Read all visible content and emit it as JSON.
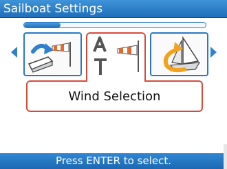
{
  "title": "Sailboat Settings",
  "progress": 0.2,
  "carousel": {
    "items": [
      {
        "name": "bow-wind-icon",
        "selected": false
      },
      {
        "name": "text-wind-icon",
        "selected": true
      },
      {
        "name": "sail-rotate-icon",
        "selected": false
      }
    ],
    "selected_label": "Wind Selection"
  },
  "footer_hint": "Press ENTER to select.",
  "colors": {
    "accent_blue": "#2a78c5",
    "selection_red": "#d64a3a",
    "title_bar": "#1f6fba"
  }
}
